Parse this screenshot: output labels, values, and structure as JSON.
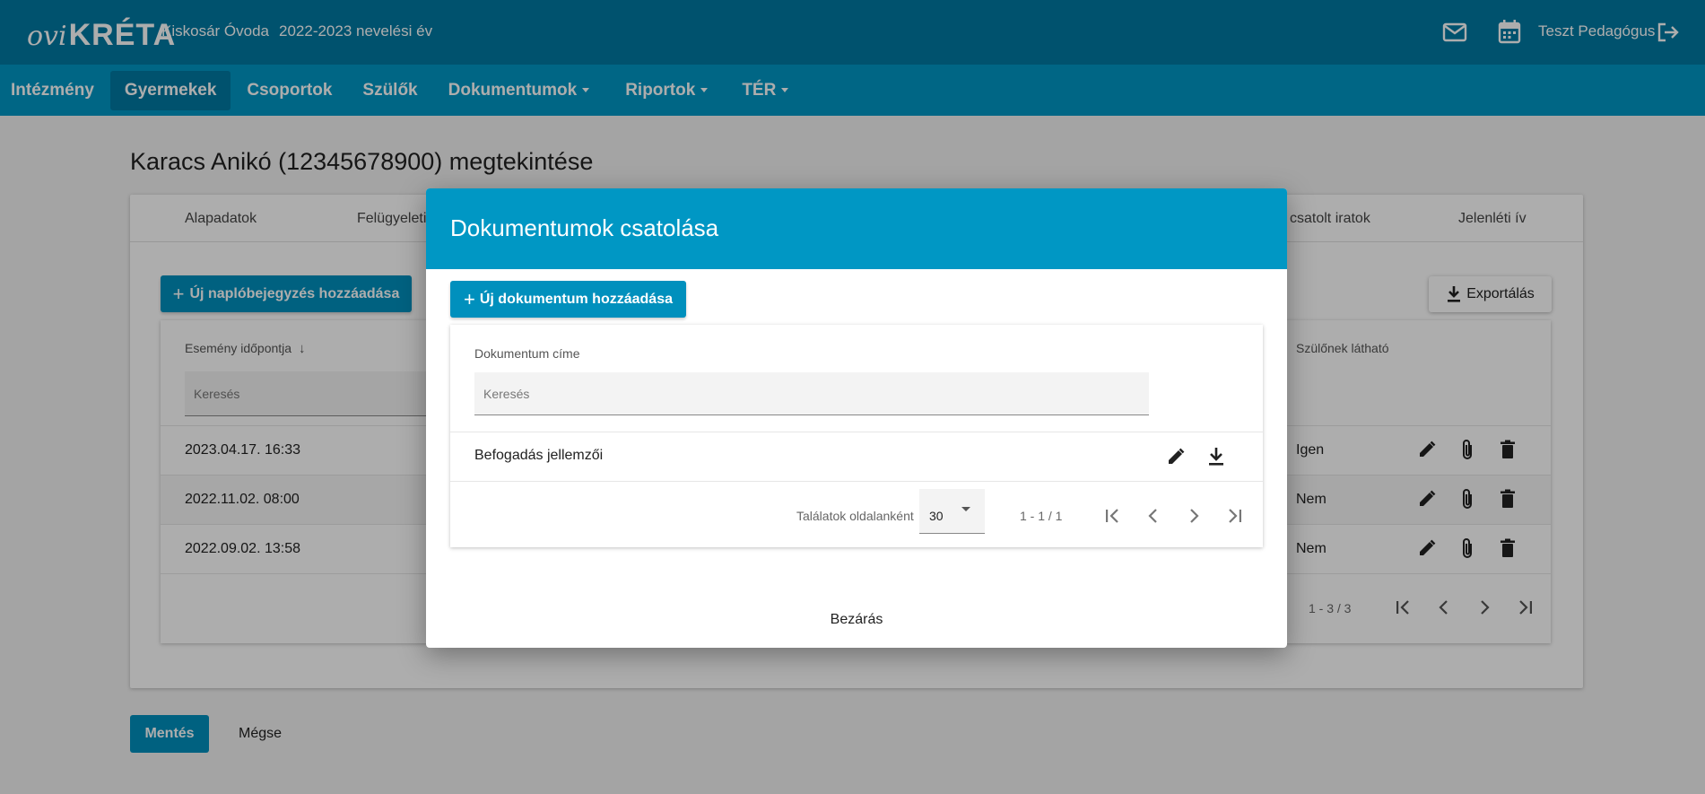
{
  "header": {
    "logo_ovi": "ovi",
    "logo_kreta": "KRÉTA",
    "school": "Kiskosár Óvoda",
    "year": "2022-2023 nevelési év",
    "username": "Teszt Pedagógus",
    "icons": [
      "mail-icon",
      "calendar-icon",
      "logout-icon"
    ]
  },
  "nav": {
    "items": [
      {
        "label": "Intézmény",
        "dropdown": false
      },
      {
        "label": "Gyermekek",
        "dropdown": false,
        "active": true
      },
      {
        "label": "Csoportok",
        "dropdown": false
      },
      {
        "label": "Szülők",
        "dropdown": false
      },
      {
        "label": "Dokumentumok",
        "dropdown": true
      },
      {
        "label": "Riportok",
        "dropdown": true
      },
      {
        "label": "TÉR",
        "dropdown": true
      }
    ]
  },
  "page": {
    "title": "Karacs Anikó (12345678900) megtekintése",
    "tabs": [
      "Alapadatok",
      "Felügyeleti",
      "csatolt iratok",
      "Jelenléti ív"
    ],
    "add_log_button": "Új naplóbejegyzés hozzáadása",
    "export_button": "Exportálás",
    "columns": {
      "event_time": "Esemény időpontja",
      "parent_visible": "Szülőnek látható"
    },
    "search_placeholder": "Keresés",
    "rows": [
      {
        "date": "2023.04.17. 16:33",
        "visible": "Igen"
      },
      {
        "date": "2022.11.02. 08:00",
        "visible": "Nem"
      },
      {
        "date": "2022.09.02. 13:58",
        "visible": "Nem"
      }
    ],
    "pager_range": "1 - 3 / 3",
    "save_button": "Mentés",
    "cancel_button": "Mégse"
  },
  "modal": {
    "title": "Dokumentumok csatolása",
    "add_button": "Új dokumentum hozzáadása",
    "column_title": "Dokumentum címe",
    "search_placeholder": "Keresés",
    "rows": [
      {
        "title": "Befogadás jellemzői"
      }
    ],
    "per_page_label": "Találatok oldalanként",
    "per_page_value": "30",
    "pager_range": "1 - 1 / 1",
    "close_button": "Bezárás"
  },
  "colors": {
    "topbar": "#007aa3",
    "navbar": "#0097c4",
    "primary_button": "#0090bd"
  }
}
